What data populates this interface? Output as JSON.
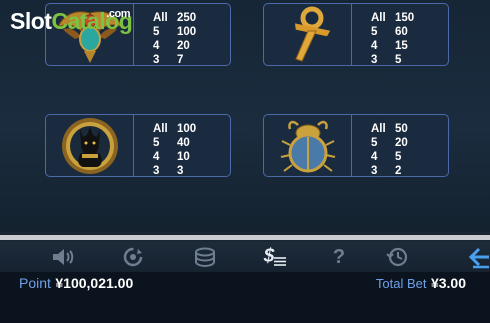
{
  "watermark": {
    "part1": "Slot",
    "part2": "Catalog",
    "suffix": ".com"
  },
  "paytable": {
    "symbols": [
      {
        "name": "winged scarab",
        "pays": [
          {
            "count": "All",
            "value": "250"
          },
          {
            "count": "5",
            "value": "100"
          },
          {
            "count": "4",
            "value": "20"
          },
          {
            "count": "3",
            "value": "7"
          }
        ]
      },
      {
        "name": "ankh",
        "pays": [
          {
            "count": "All",
            "value": "150"
          },
          {
            "count": "5",
            "value": "60"
          },
          {
            "count": "4",
            "value": "15"
          },
          {
            "count": "3",
            "value": "5"
          }
        ]
      },
      {
        "name": "bastet cat",
        "pays": [
          {
            "count": "All",
            "value": "100"
          },
          {
            "count": "5",
            "value": "40"
          },
          {
            "count": "4",
            "value": "10"
          },
          {
            "count": "3",
            "value": "3"
          }
        ]
      },
      {
        "name": "scarab beetle",
        "pays": [
          {
            "count": "All",
            "value": "50"
          },
          {
            "count": "5",
            "value": "20"
          },
          {
            "count": "4",
            "value": "5"
          },
          {
            "count": "3",
            "value": "2"
          }
        ]
      }
    ]
  },
  "toolbar": {
    "icons": [
      "speaker-icon",
      "autospin-icon",
      "coins-icon",
      "paytable-icon",
      "help-icon",
      "history-icon",
      "back-icon"
    ],
    "help_glyph": "?",
    "paytable_glyph": "$"
  },
  "status": {
    "point_label": "Point",
    "point_value": "¥100,021.00",
    "total_bet_label": "Total Bet",
    "total_bet_value": "¥3.00"
  },
  "colors": {
    "card_border": "#4c6aa8",
    "accent_blue": "#6ea0e8",
    "gold": "#d4a63a"
  }
}
